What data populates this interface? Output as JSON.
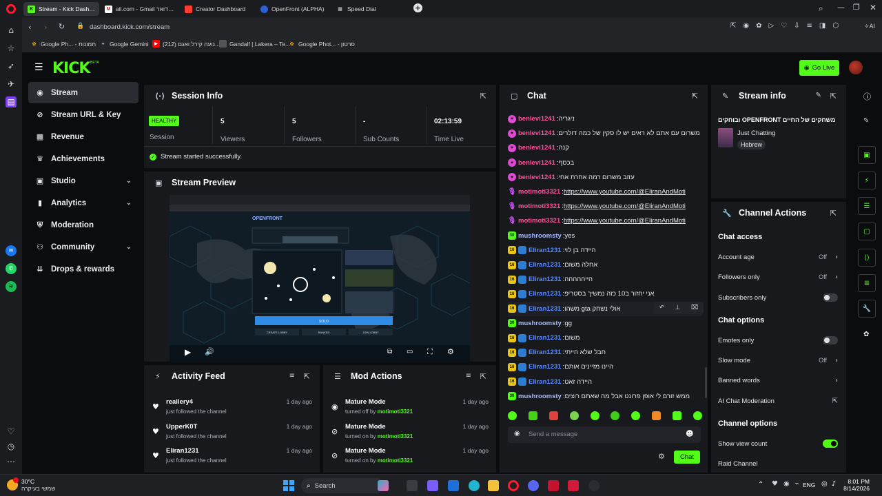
{
  "browser": {
    "tabs": [
      {
        "label": "Stream - Kick Dashboard",
        "icon": "kick-icon",
        "active": true
      },
      {
        "label": "ail.com - Gmail נכנס דואר",
        "icon": "gmail-icon"
      },
      {
        "label": "Creator Dashboard",
        "icon": "creator-icon"
      },
      {
        "label": "OpenFront (ALPHA)",
        "icon": "openfront-icon"
      },
      {
        "label": "Speed Dial",
        "icon": "speed-dial-icon"
      }
    ],
    "url": "dashboard.kick.com/stream",
    "bookmarks": [
      {
        "label": "Google Ph... - תמונות",
        "icon": "google-photos-icon"
      },
      {
        "label": "Google Gemini",
        "icon": "gemini-icon"
      },
      {
        "label": "(212) נועה קירל ואגם...",
        "icon": "youtube-icon"
      },
      {
        "label": "Gandalf | Lakera – Te...",
        "icon": "gandalf-icon"
      },
      {
        "label": "Google Phot... - סרטון",
        "icon": "google-photos-icon"
      }
    ]
  },
  "header": {
    "logo": "KICK",
    "logo_sup": "BETA",
    "go_live_label": "Go Live"
  },
  "sidebar": {
    "items": [
      {
        "label": "Stream",
        "icon": "stream-icon",
        "active": true
      },
      {
        "label": "Stream URL & Key",
        "icon": "link-icon"
      },
      {
        "label": "Revenue",
        "icon": "revenue-icon"
      },
      {
        "label": "Achievements",
        "icon": "trophy-icon"
      },
      {
        "label": "Studio",
        "icon": "studio-icon",
        "expandable": true
      },
      {
        "label": "Analytics",
        "icon": "analytics-icon",
        "expandable": true
      },
      {
        "label": "Moderation",
        "icon": "moderation-icon"
      },
      {
        "label": "Community",
        "icon": "community-icon",
        "expandable": true
      },
      {
        "label": "Drops & rewards",
        "icon": "drops-icon"
      }
    ]
  },
  "session": {
    "title": "Session Info",
    "health": "HEALTHY",
    "health_label": "Session",
    "stats": [
      {
        "value": "5",
        "label": "Viewers"
      },
      {
        "value": "5",
        "label": "Followers"
      },
      {
        "value": "-",
        "label": "Sub Counts"
      },
      {
        "value": "02:13:59",
        "label": "Time Live"
      }
    ],
    "message": "Stream started successfully."
  },
  "preview": {
    "title": "Stream Preview",
    "game_title": "OPENFRONT",
    "buttons": [
      "CREATE LOBBY",
      "RANKED",
      "JOIN LOBBY"
    ],
    "play_label": "SOLO"
  },
  "activity": {
    "title": "Activity Feed",
    "items": [
      {
        "name": "reallery4",
        "text": "just followed the channel",
        "time": "1 day ago"
      },
      {
        "name": "UpperK0T",
        "text": "just followed the channel",
        "time": "1 day ago"
      },
      {
        "name": "Eliran1231",
        "text": "just followed the channel",
        "time": "1 day ago"
      }
    ]
  },
  "mod_actions": {
    "title": "Mod Actions",
    "items": [
      {
        "name": "Mature Mode",
        "text": "turned off by",
        "by": "motimoti3321",
        "time": "1 day ago",
        "icon": "eye-icon"
      },
      {
        "name": "Mature Mode",
        "text": "turned on by",
        "by": "motimoti3321",
        "time": "1 day ago",
        "icon": "eye-off-icon"
      },
      {
        "name": "Mature Mode",
        "text": "turned on by",
        "by": "motimoti3321",
        "time": "1 day ago",
        "icon": "eye-off-icon"
      }
    ]
  },
  "chat": {
    "title": "Chat",
    "messages": [
      {
        "user": "benlevi1241",
        "text": "ניגריה",
        "color": "#ff4f9a",
        "badge": "gift"
      },
      {
        "user": "benlevi1241",
        "text": "משרום עם אתם לא ראים יש לו סקין של כמה דולרים",
        "color": "#ff4f9a",
        "badge": "gift"
      },
      {
        "user": "benlevi1241",
        "text": "קנה",
        "color": "#ff4f9a",
        "badge": "gift"
      },
      {
        "user": "benlevi1241",
        "text": "בכסף",
        "color": "#ff4f9a",
        "badge": "gift"
      },
      {
        "user": "benlevi1241",
        "text": "עזוב משרום רמה אחרת אחי",
        "color": "#ff4f9a",
        "badge": "gift"
      },
      {
        "user": "motimoti3321",
        "text": "https://www.youtube.com/@EliranAndMoti",
        "color": "#ff4f9a",
        "badge": "mic",
        "link": true
      },
      {
        "user": "motimoti3321",
        "text": "https://www.youtube.com/@EliranAndMoti",
        "color": "#ff4f9a",
        "badge": "mic",
        "link": true
      },
      {
        "user": "motimoti3321",
        "text": "https://www.youtube.com/@EliranAndMoti",
        "color": "#ff4f9a",
        "badge": "mic",
        "link": true
      },
      {
        "user": "mushroomsty",
        "text": "yes",
        "color": "#a8b9ff",
        "badge": "30"
      },
      {
        "user": "Eliran1231",
        "text": "היידה בן לוי",
        "color": "#5b8cff",
        "badge": "16"
      },
      {
        "user": "Eliran1231",
        "text": "אחלה משום",
        "color": "#5b8cff",
        "badge": "16"
      },
      {
        "user": "Eliran1231",
        "text": "הייההההה",
        "color": "#5b8cff",
        "badge": "16"
      },
      {
        "user": "Eliran1231",
        "text": "אני יחזור ב10 כזה נמשיך בסטריפ",
        "color": "#5b8cff",
        "badge": "16"
      },
      {
        "user": "Eliran1231",
        "text": "משהו gta אולי נשחק",
        "color": "#5b8cff",
        "badge": "16",
        "hover": true
      },
      {
        "user": "mushroomsty",
        "text": "gg",
        "color": "#a8b9ff",
        "badge": "30"
      },
      {
        "user": "Eliran1231",
        "text": "משום",
        "color": "#5b8cff",
        "badge": "16"
      },
      {
        "user": "Eliran1231",
        "text": "חבל שלא הייתי",
        "color": "#5b8cff",
        "badge": "16"
      },
      {
        "user": "Eliran1231",
        "text": "היינו מזיינים אותם",
        "color": "#5b8cff",
        "badge": "16"
      },
      {
        "user": "Eliran1231",
        "text": "היידה זאט",
        "color": "#5b8cff",
        "badge": "16"
      },
      {
        "user": "mushroomsty",
        "text": "ממש זורם לי אופן פרונט אבל מה שאתם רוצים",
        "color": "#a8b9ff",
        "badge": "30"
      }
    ],
    "placeholder": "Send a message",
    "send_label": "Chat"
  },
  "stream_info": {
    "title": "Stream info",
    "stream_title": "משחקים של החיים OPENFRONT ובוחקים",
    "category": "Just Chatting",
    "tag": "Hebrew"
  },
  "channel_actions": {
    "title": "Channel Actions",
    "chat_access_title": "Chat access",
    "chat_access": [
      {
        "label": "Account age",
        "value": "Off",
        "control": "chevron"
      },
      {
        "label": "Followers only",
        "value": "Off",
        "control": "chevron"
      },
      {
        "label": "Subscribers only",
        "control": "toggle",
        "on": false
      }
    ],
    "chat_options_title": "Chat options",
    "chat_options": [
      {
        "label": "Emotes only",
        "control": "toggle",
        "on": false
      },
      {
        "label": "Slow mode",
        "value": "Off",
        "control": "chevron"
      },
      {
        "label": "Banned words",
        "control": "chevron"
      },
      {
        "label": "AI Chat Moderation",
        "control": "external"
      }
    ],
    "channel_options_title": "Channel options",
    "channel_options": [
      {
        "label": "Show view count",
        "control": "toggle",
        "on": true
      },
      {
        "label": "Raid Channel",
        "control": "none"
      }
    ]
  },
  "taskbar": {
    "weather_temp": "30°C",
    "weather_text": "שמשי בעיקרה",
    "search_label": "Search",
    "lang": "ENG",
    "time": "8:01 PM",
    "date": "8/14/2026"
  },
  "colors": {
    "accent": "#53fc18",
    "panel": "#18191d",
    "bg": "#0b0c0e"
  }
}
